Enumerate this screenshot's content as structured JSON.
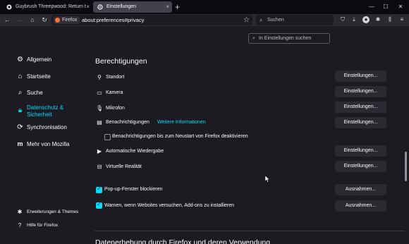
{
  "tabs": [
    {
      "title": "Guybrush Threepwood: Return t",
      "close": "×"
    },
    {
      "title": "Einstellungen",
      "close": "×"
    }
  ],
  "new_tab": "+",
  "window_controls": {
    "minimize": "—",
    "maximize": "☐",
    "close": "✕"
  },
  "nav": {
    "identity_label": "Firefox",
    "url": "about:preferences#privacy",
    "search_placeholder": "Suchen"
  },
  "find_placeholder": "In Einstellungen suchen",
  "sidebar": {
    "items": [
      {
        "label": "Allgemein",
        "icon": "gear-icon"
      },
      {
        "label": "Startseite",
        "icon": "home-icon"
      },
      {
        "label": "Suche",
        "icon": "search-icon"
      },
      {
        "label": "Datenschutz &",
        "label2": "Sicherheit",
        "icon": "lock-icon",
        "active": true
      },
      {
        "label": "Synchronisation",
        "icon": "sync-icon"
      },
      {
        "label": "Mehr von Mozilla",
        "icon": "mozilla-icon"
      }
    ],
    "footer": [
      {
        "label": "Erweiterungen & Themes",
        "icon": "puzzle-icon"
      },
      {
        "label": "Hilfe für Firefox",
        "icon": "help-icon"
      }
    ]
  },
  "permissions": {
    "title": "Berechtigungen",
    "rows": [
      {
        "label": "Standort",
        "button": "Einstellungen..."
      },
      {
        "label": "Kamera",
        "button": "Einstellungen..."
      },
      {
        "label": "Mikrofon",
        "button": "Einstellungen..."
      },
      {
        "label": "Benachrichtigungen",
        "link": "Weitere Informationen",
        "button": "Einstellungen..."
      },
      {
        "label": "Automatische Wiedergabe",
        "button": "Einstellungen..."
      },
      {
        "label": "Virtuelle Realität",
        "button": "Einstellungen..."
      }
    ],
    "notif_pause": "Benachrichtigungen bis zum Neustart von Firefox deaktivieren",
    "popup_block": "Pop-up-Fenster blockieren",
    "popup_button": "Ausnahmen...",
    "addon_warn": "Warnen, wenn Websites versuchen, Add-ons zu installieren",
    "addon_button": "Ausnahmen..."
  },
  "next_section_title": "Datenerhebung durch Firefox und deren Verwendung",
  "colors": {
    "accent": "#00ddff",
    "background": "#1c1b22",
    "button": "#2b2a33"
  }
}
